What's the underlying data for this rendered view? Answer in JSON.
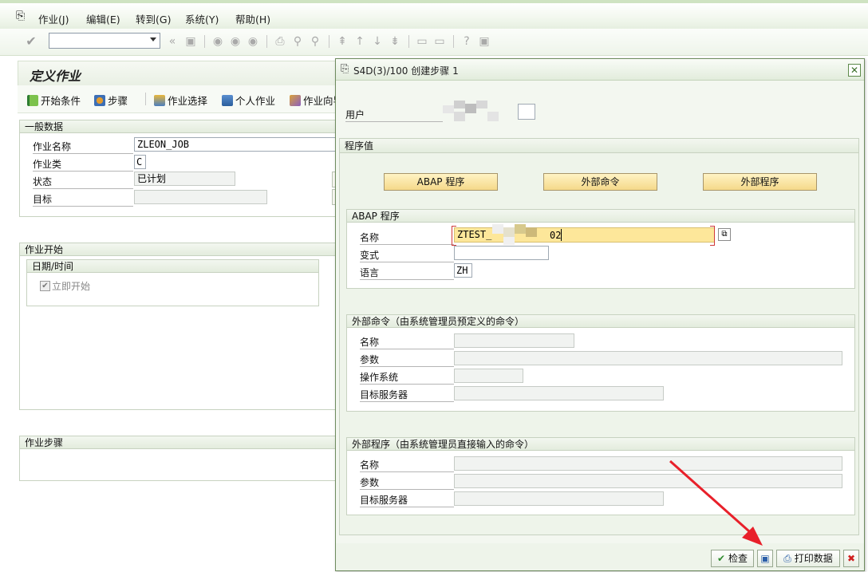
{
  "menu": {
    "items": [
      "作业(J)",
      "编辑(E)",
      "转到(G)",
      "系统(Y)",
      "帮助(H)"
    ]
  },
  "background": {
    "title": "定义作业",
    "appbar": [
      "开始条件",
      "步骤",
      "作业选择",
      "个人作业",
      "作业向导"
    ],
    "general": {
      "header": "一般数据",
      "job_name_label": "作业名称",
      "job_name": "ZLEON_JOB",
      "job_class_label": "作业类",
      "job_class": "C",
      "status_label": "状态",
      "status": "已计划",
      "target_label": "目标",
      "target": ""
    },
    "start": {
      "header": "作业开始",
      "datetime_header": "日期/时间",
      "immediate_label": "立即开始"
    },
    "steps": {
      "header": "作业步骤"
    }
  },
  "dialog": {
    "title": "S4D(3)/100 创建步骤 1",
    "user_label": "用户",
    "program_values_header": "程序值",
    "buttons": {
      "abap": "ABAP 程序",
      "external_command": "外部命令",
      "external_program": "外部程序"
    },
    "abap": {
      "header": "ABAP 程序",
      "name_label": "名称",
      "name_value_start": "ZTEST_",
      "name_value_end": "02",
      "variant_label": "变式",
      "variant": "",
      "language_label": "语言",
      "language": "ZH"
    },
    "ext_cmd": {
      "header": "外部命令（由系统管理员预定义的命令）",
      "name_label": "名称",
      "params_label": "参数",
      "os_label": "操作系统",
      "target_server_label": "目标服务器"
    },
    "ext_prog": {
      "header": "外部程序（由系统管理员直接输入的命令）",
      "name_label": "名称",
      "params_label": "参数",
      "target_server_label": "目标服务器"
    },
    "footer": {
      "check": "检查",
      "print_data": "打印数据"
    }
  },
  "colors": {
    "accent_green": "#5e8a4b",
    "button_yellow": "#f5d98a",
    "annotation_red": "#e8202a"
  }
}
